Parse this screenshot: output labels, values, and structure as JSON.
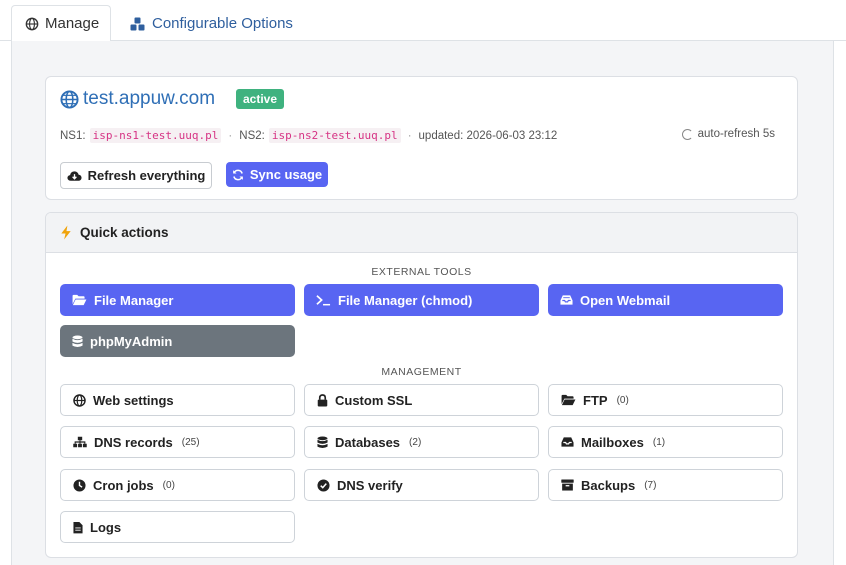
{
  "tabs": [
    {
      "label": "Manage",
      "icon": "globe-icon",
      "active": true
    },
    {
      "label": "Configurable Options",
      "icon": "cubes-icon",
      "active": false
    }
  ],
  "domain": {
    "name": "test.appuw.com",
    "status": "active",
    "ns1_label": "NS1:",
    "ns1": "isp-ns1-test.uuq.pl",
    "ns2_label": "NS2:",
    "ns2": "isp-ns2-test.uuq.pl",
    "updated": "updated: 2026-06-03 23:12",
    "autorefresh": "auto-refresh 5s",
    "refresh_label": "Refresh everything",
    "sync_label": "Sync usage"
  },
  "quick_actions": {
    "title": "Quick actions",
    "external_label": "EXTERNAL TOOLS",
    "management_label": "MANAGEMENT",
    "external": [
      {
        "label": "File Manager",
        "icon": "folder-open-icon"
      },
      {
        "label": "File Manager (chmod)",
        "icon": "terminal-icon"
      },
      {
        "label": "Open Webmail",
        "icon": "inbox-icon"
      },
      {
        "label": "phpMyAdmin",
        "icon": "database-icon"
      }
    ],
    "management": [
      {
        "label": "Web settings",
        "count": "",
        "icon": "globe-icon"
      },
      {
        "label": "Custom SSL",
        "count": "",
        "icon": "lock-icon"
      },
      {
        "label": "FTP",
        "count": "(0)",
        "icon": "folder-open-icon"
      },
      {
        "label": "DNS records",
        "count": "(25)",
        "icon": "sitemap-icon"
      },
      {
        "label": "Databases",
        "count": "(2)",
        "icon": "database-icon"
      },
      {
        "label": "Mailboxes",
        "count": "(1)",
        "icon": "inbox-icon"
      },
      {
        "label": "Cron jobs",
        "count": "(0)",
        "icon": "clock-icon"
      },
      {
        "label": "DNS verify",
        "count": "",
        "icon": "check-circle-icon"
      },
      {
        "label": "Backups",
        "count": "(7)",
        "icon": "archive-icon"
      },
      {
        "label": "Logs",
        "count": "",
        "icon": "file-icon"
      }
    ]
  },
  "colors": {
    "primary": "#5865f2",
    "secondary": "#6c757d",
    "success": "#3fb27f",
    "link": "#2f6fb6"
  }
}
